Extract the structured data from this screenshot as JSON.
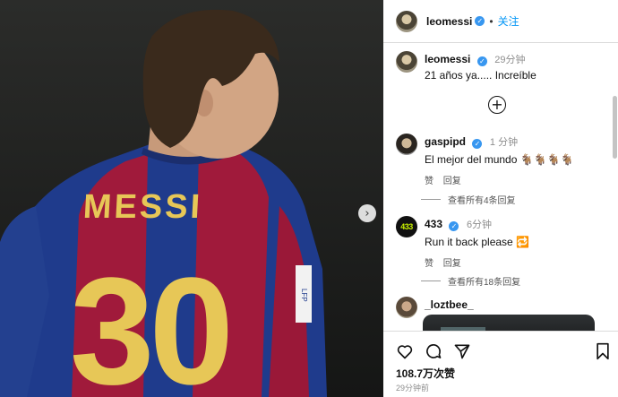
{
  "post": {
    "jersey_name": "MESSI",
    "jersey_number": "30",
    "sleeve_patch": "LFP"
  },
  "header": {
    "username": "leomessi",
    "verified": "✓",
    "separator": "•",
    "follow_label": "关注"
  },
  "caption": {
    "username": "leomessi",
    "time": "29分钟",
    "text": "21 años ya..... Increíble"
  },
  "comments": [
    {
      "username": "gaspipd",
      "verified": "✓",
      "time": "1 分钟",
      "text": "El mejor del mundo 🐐🐐🐐🐐",
      "like_label": "赞",
      "reply_label": "回复",
      "view_replies": "查看所有4条回复"
    },
    {
      "username": "433",
      "avatar_text": "433",
      "verified": "✓",
      "time": "6分钟",
      "text": "Run it back please 🔁",
      "like_label": "赞",
      "reply_label": "回复",
      "view_replies": "查看所有18条回复"
    },
    {
      "username": "_loztbee_"
    }
  ],
  "footer": {
    "likes": "108.7万次赞",
    "time_ago": "29分钟前"
  },
  "icons": [
    "heart-icon",
    "comment-icon",
    "share-icon",
    "bookmark-icon",
    "add-circle-icon",
    "chevron-right-icon",
    "verified-icon"
  ]
}
